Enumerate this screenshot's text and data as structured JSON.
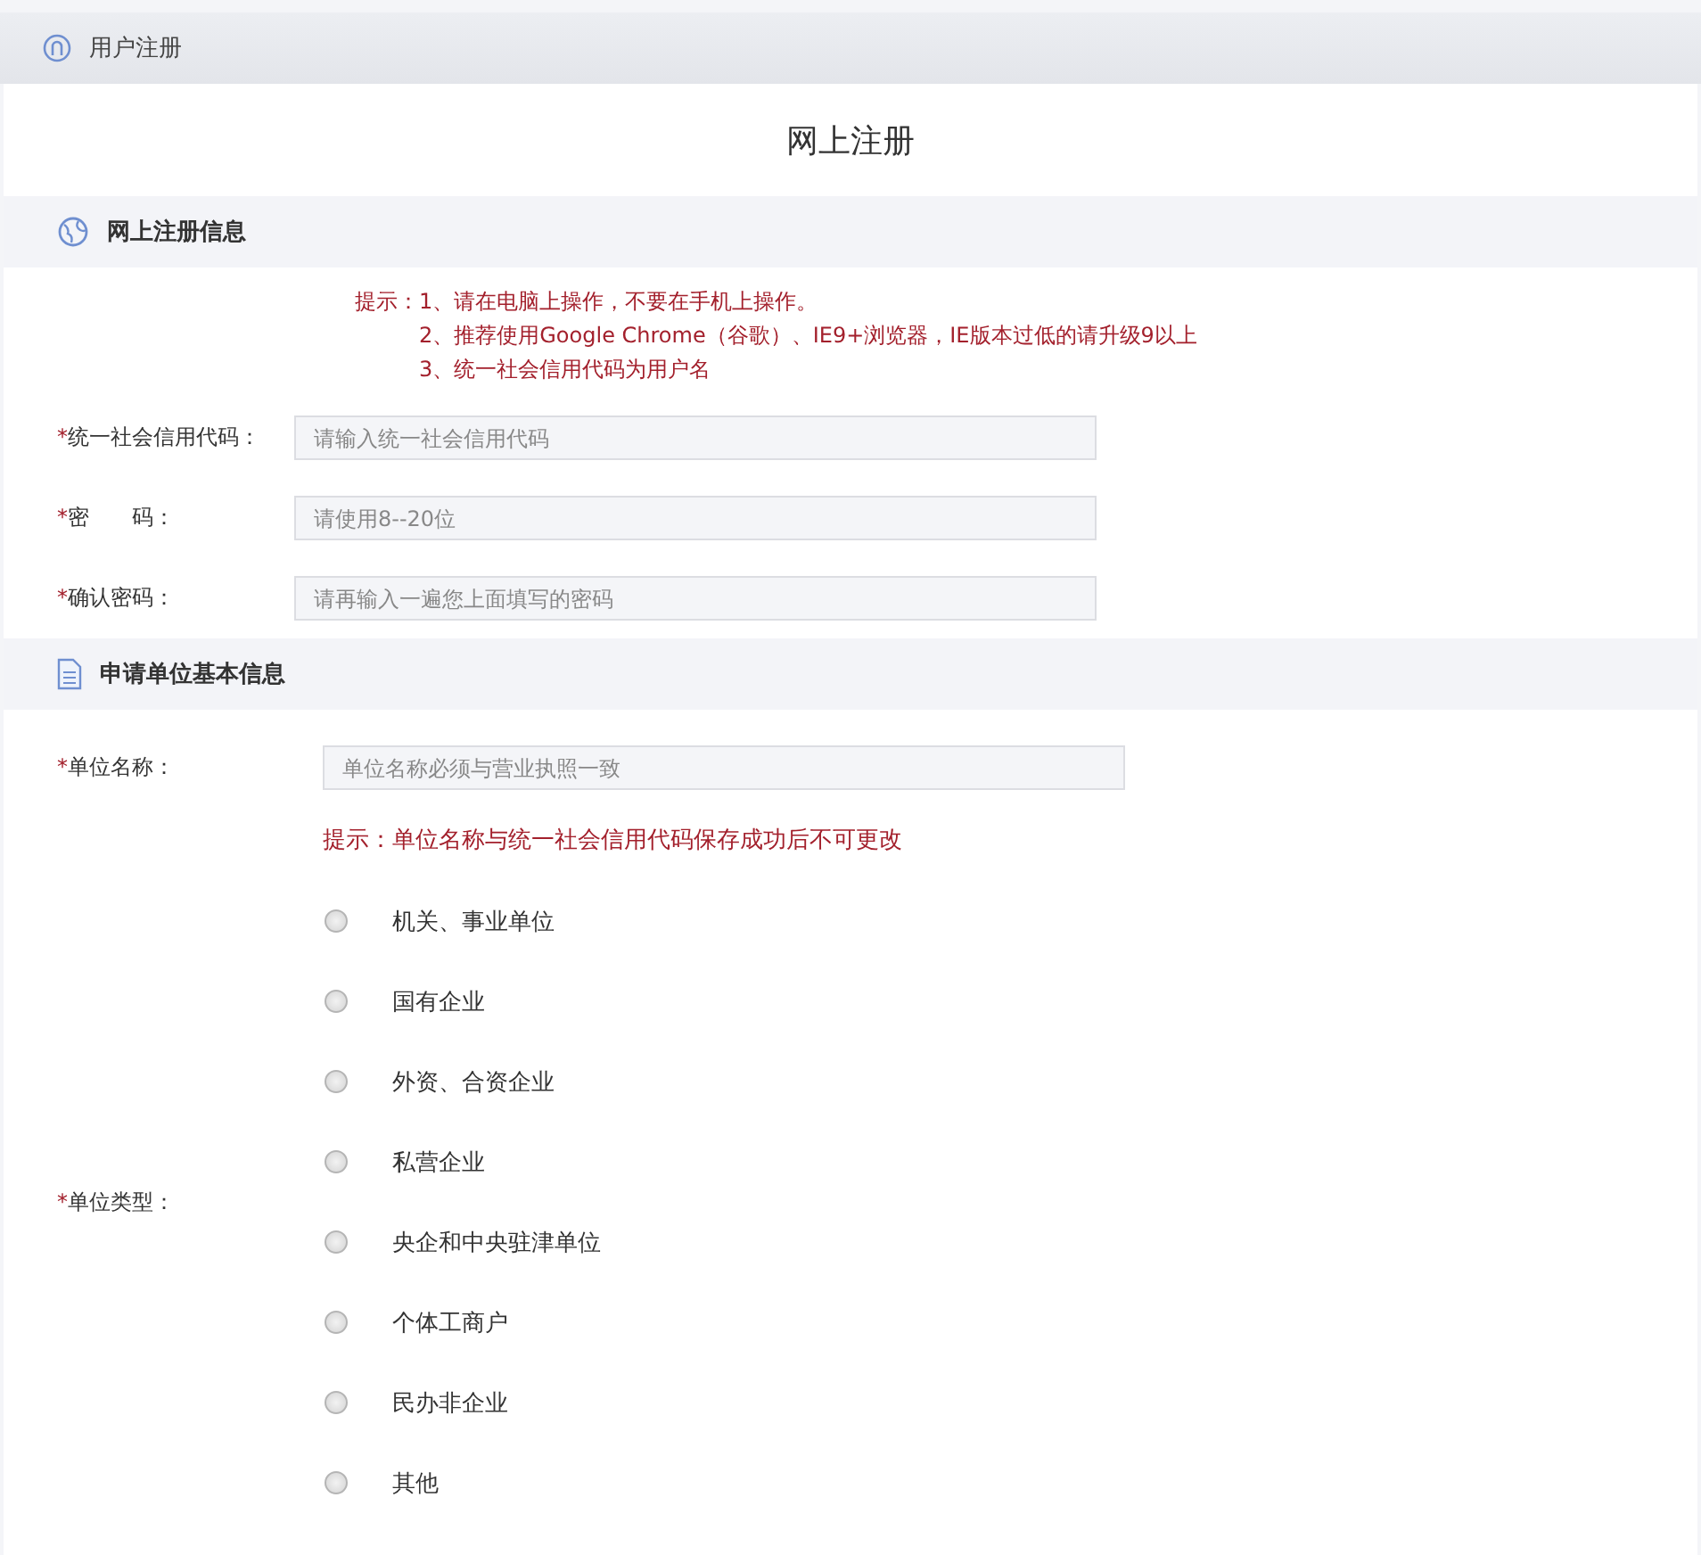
{
  "header": {
    "title": "用户注册"
  },
  "page_title": "网上注册",
  "sections": [
    {
      "title": "网上注册信息",
      "tip": {
        "prefix": "提示：",
        "lines": [
          "1、请在电脑上操作，不要在手机上操作。",
          "2、推荐使用Google Chrome（谷歌）、IE9+浏览器，IE版本过低的请升级9以上",
          "3、统一社会信用代码为用户名"
        ]
      },
      "fields": [
        {
          "mark": "*",
          "label": "统一社会信用代码：",
          "placeholder": "请输入统一社会信用代码"
        },
        {
          "mark": "*",
          "label": "密　　码：",
          "placeholder": "请使用8--20位"
        },
        {
          "mark": "*",
          "label": "确认密码：",
          "placeholder": "请再输入一遍您上面填写的密码"
        }
      ]
    },
    {
      "title": "申请单位基本信息",
      "fields": [
        {
          "mark": "*",
          "label": "单位名称：",
          "placeholder": "单位名称必须与营业执照一致"
        }
      ],
      "note": "提示：单位名称与统一社会信用代码保存成功后不可更改",
      "radio_group": {
        "mark": "*",
        "label": "单位类型：",
        "options": [
          {
            "label": "机关、事业单位",
            "selected": false
          },
          {
            "label": "国有企业",
            "selected": false
          },
          {
            "label": "外资、合资企业",
            "selected": false
          },
          {
            "label": "私营企业",
            "selected": false
          },
          {
            "label": "央企和中央驻津单位",
            "selected": false
          },
          {
            "label": "个体工商户",
            "selected": false
          },
          {
            "label": "民办非企业",
            "selected": false
          },
          {
            "label": "其他",
            "selected": false
          }
        ]
      }
    }
  ]
}
